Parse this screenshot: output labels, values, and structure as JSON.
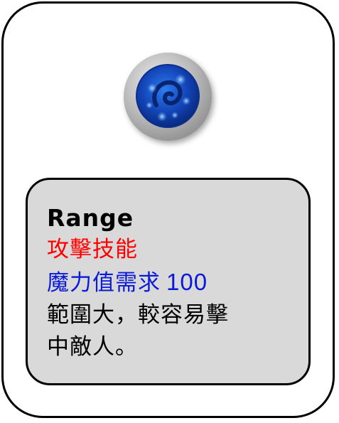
{
  "skill": {
    "name": "Range",
    "type": "攻擊技能",
    "mana_label": "魔力值需求",
    "mana_value": "100",
    "description_line1": "範圍大，較容易擊",
    "description_line2": "中敵人。"
  },
  "icon": {
    "name": "magic-orb-icon",
    "ring_color": "#b8b8b8",
    "core_color": "#1f5fd6"
  },
  "colors": {
    "card_border": "#000000",
    "info_background": "#d9d9d9",
    "type_text": "#ff0000",
    "mana_text": "#0a1ad6"
  }
}
